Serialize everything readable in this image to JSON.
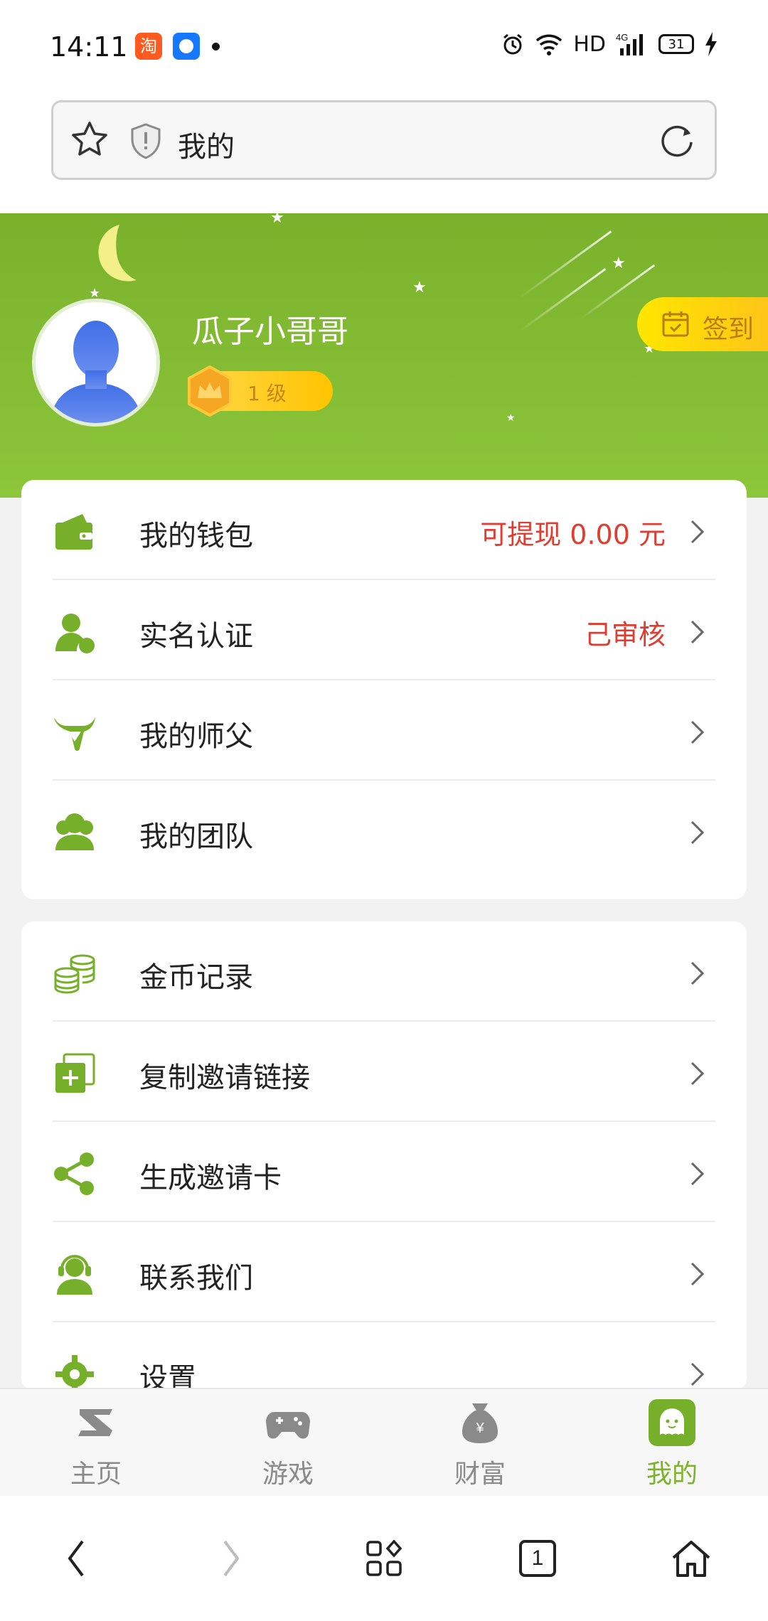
{
  "status_bar": {
    "time": "14:11",
    "app1_glyph": "淘",
    "network": "HD",
    "signal": "4G",
    "battery": "31"
  },
  "address_bar": {
    "title": "我的"
  },
  "profile": {
    "username": "瓜子小哥哥",
    "level": "1 级",
    "signin_label": "签到"
  },
  "menu_group_1": [
    {
      "label": "我的钱包",
      "value": "可提现 0.00 元",
      "icon": "wallet-icon"
    },
    {
      "label": "实名认证",
      "value": "己审核",
      "icon": "user-verify-icon"
    },
    {
      "label": "我的师父",
      "value": "",
      "icon": "mentor-icon"
    },
    {
      "label": "我的团队",
      "value": "",
      "icon": "team-icon"
    }
  ],
  "menu_group_2": [
    {
      "label": "金币记录",
      "icon": "coins-icon"
    },
    {
      "label": "复制邀请链接",
      "icon": "copy-link-icon"
    },
    {
      "label": "生成邀请卡",
      "icon": "share-icon"
    },
    {
      "label": "联系我们",
      "icon": "support-icon"
    },
    {
      "label": "设置",
      "icon": "settings-icon"
    }
  ],
  "tabs": [
    {
      "label": "主页",
      "icon": "home-z-icon",
      "active": false
    },
    {
      "label": "游戏",
      "icon": "gamepad-icon",
      "active": false
    },
    {
      "label": "财富",
      "icon": "money-bag-icon",
      "active": false
    },
    {
      "label": "我的",
      "icon": "profile-face-icon",
      "active": true
    }
  ],
  "browser_nav": {
    "tab_count": "1"
  },
  "colors": {
    "brand_green": "#7cb32a",
    "accent_red": "#e03c2f",
    "signin_yellow": "#ffd400"
  }
}
